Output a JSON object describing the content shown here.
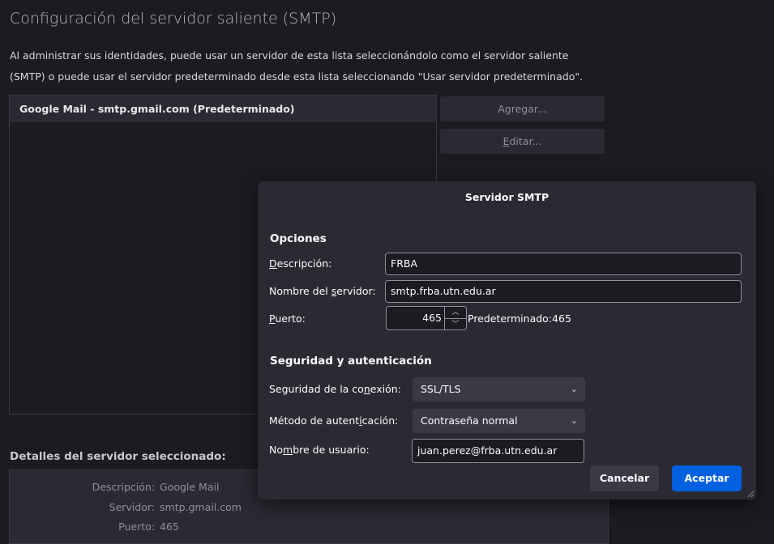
{
  "page": {
    "title": "Configuración del servidor saliente (SMTP)",
    "intro_line1": "Al administrar sus identidades, puede usar un servidor de esta lista seleccionándolo como el servidor saliente",
    "intro_line2": "(SMTP) o puede usar el servidor predeterminado desde esta lista seleccionando \"Usar servidor predeterminado\"."
  },
  "server_list": {
    "items": [
      {
        "label": "Google Mail - smtp.gmail.com (Predeterminado)"
      }
    ]
  },
  "buttons": {
    "add": "Agregar...",
    "edit_prefix": "",
    "edit_access": "E",
    "edit_rest": "ditar..."
  },
  "details": {
    "title": "Detalles del servidor seleccionado:",
    "rows": [
      {
        "key": "Descripción:",
        "value": "Google Mail"
      },
      {
        "key": "Servidor:",
        "value": "smtp.gmail.com"
      },
      {
        "key": "Puerto:",
        "value": "465"
      }
    ]
  },
  "dialog": {
    "title": "Servidor SMTP",
    "options_heading": "Opciones",
    "description_label": {
      "pre": "",
      "key": "D",
      "post": "escripción:"
    },
    "description_value": "FRBA",
    "server_label": {
      "pre": "Nombre del ",
      "key": "s",
      "post": "ervidor:"
    },
    "server_value": "smtp.frba.utn.edu.ar",
    "port_label": {
      "pre": "",
      "key": "P",
      "post": "uerto:"
    },
    "port_value": "465",
    "port_default": "Predeterminado:465",
    "security_heading": "Seguridad y autenticación",
    "conn_security_label": {
      "pre": "Seguridad de la co",
      "key": "n",
      "post": "exión:"
    },
    "conn_security_value": "SSL/TLS",
    "auth_method_label": {
      "pre": "Método de autent",
      "key": "i",
      "post": "cación:"
    },
    "auth_method_value": "Contraseña normal",
    "username_label": {
      "pre": "No",
      "key": "m",
      "post": "bre de usuario:"
    },
    "username_value": "juan.perez@frba.utn.edu.ar",
    "cancel": "Cancelar",
    "accept": "Aceptar"
  },
  "icons": {
    "spin_up": "chevron-up-icon",
    "spin_down": "chevron-down-icon",
    "select": "chevron-down-icon"
  },
  "colors": {
    "accent": "#0060df",
    "background": "#1c1b22",
    "panel": "#2b2a33"
  }
}
